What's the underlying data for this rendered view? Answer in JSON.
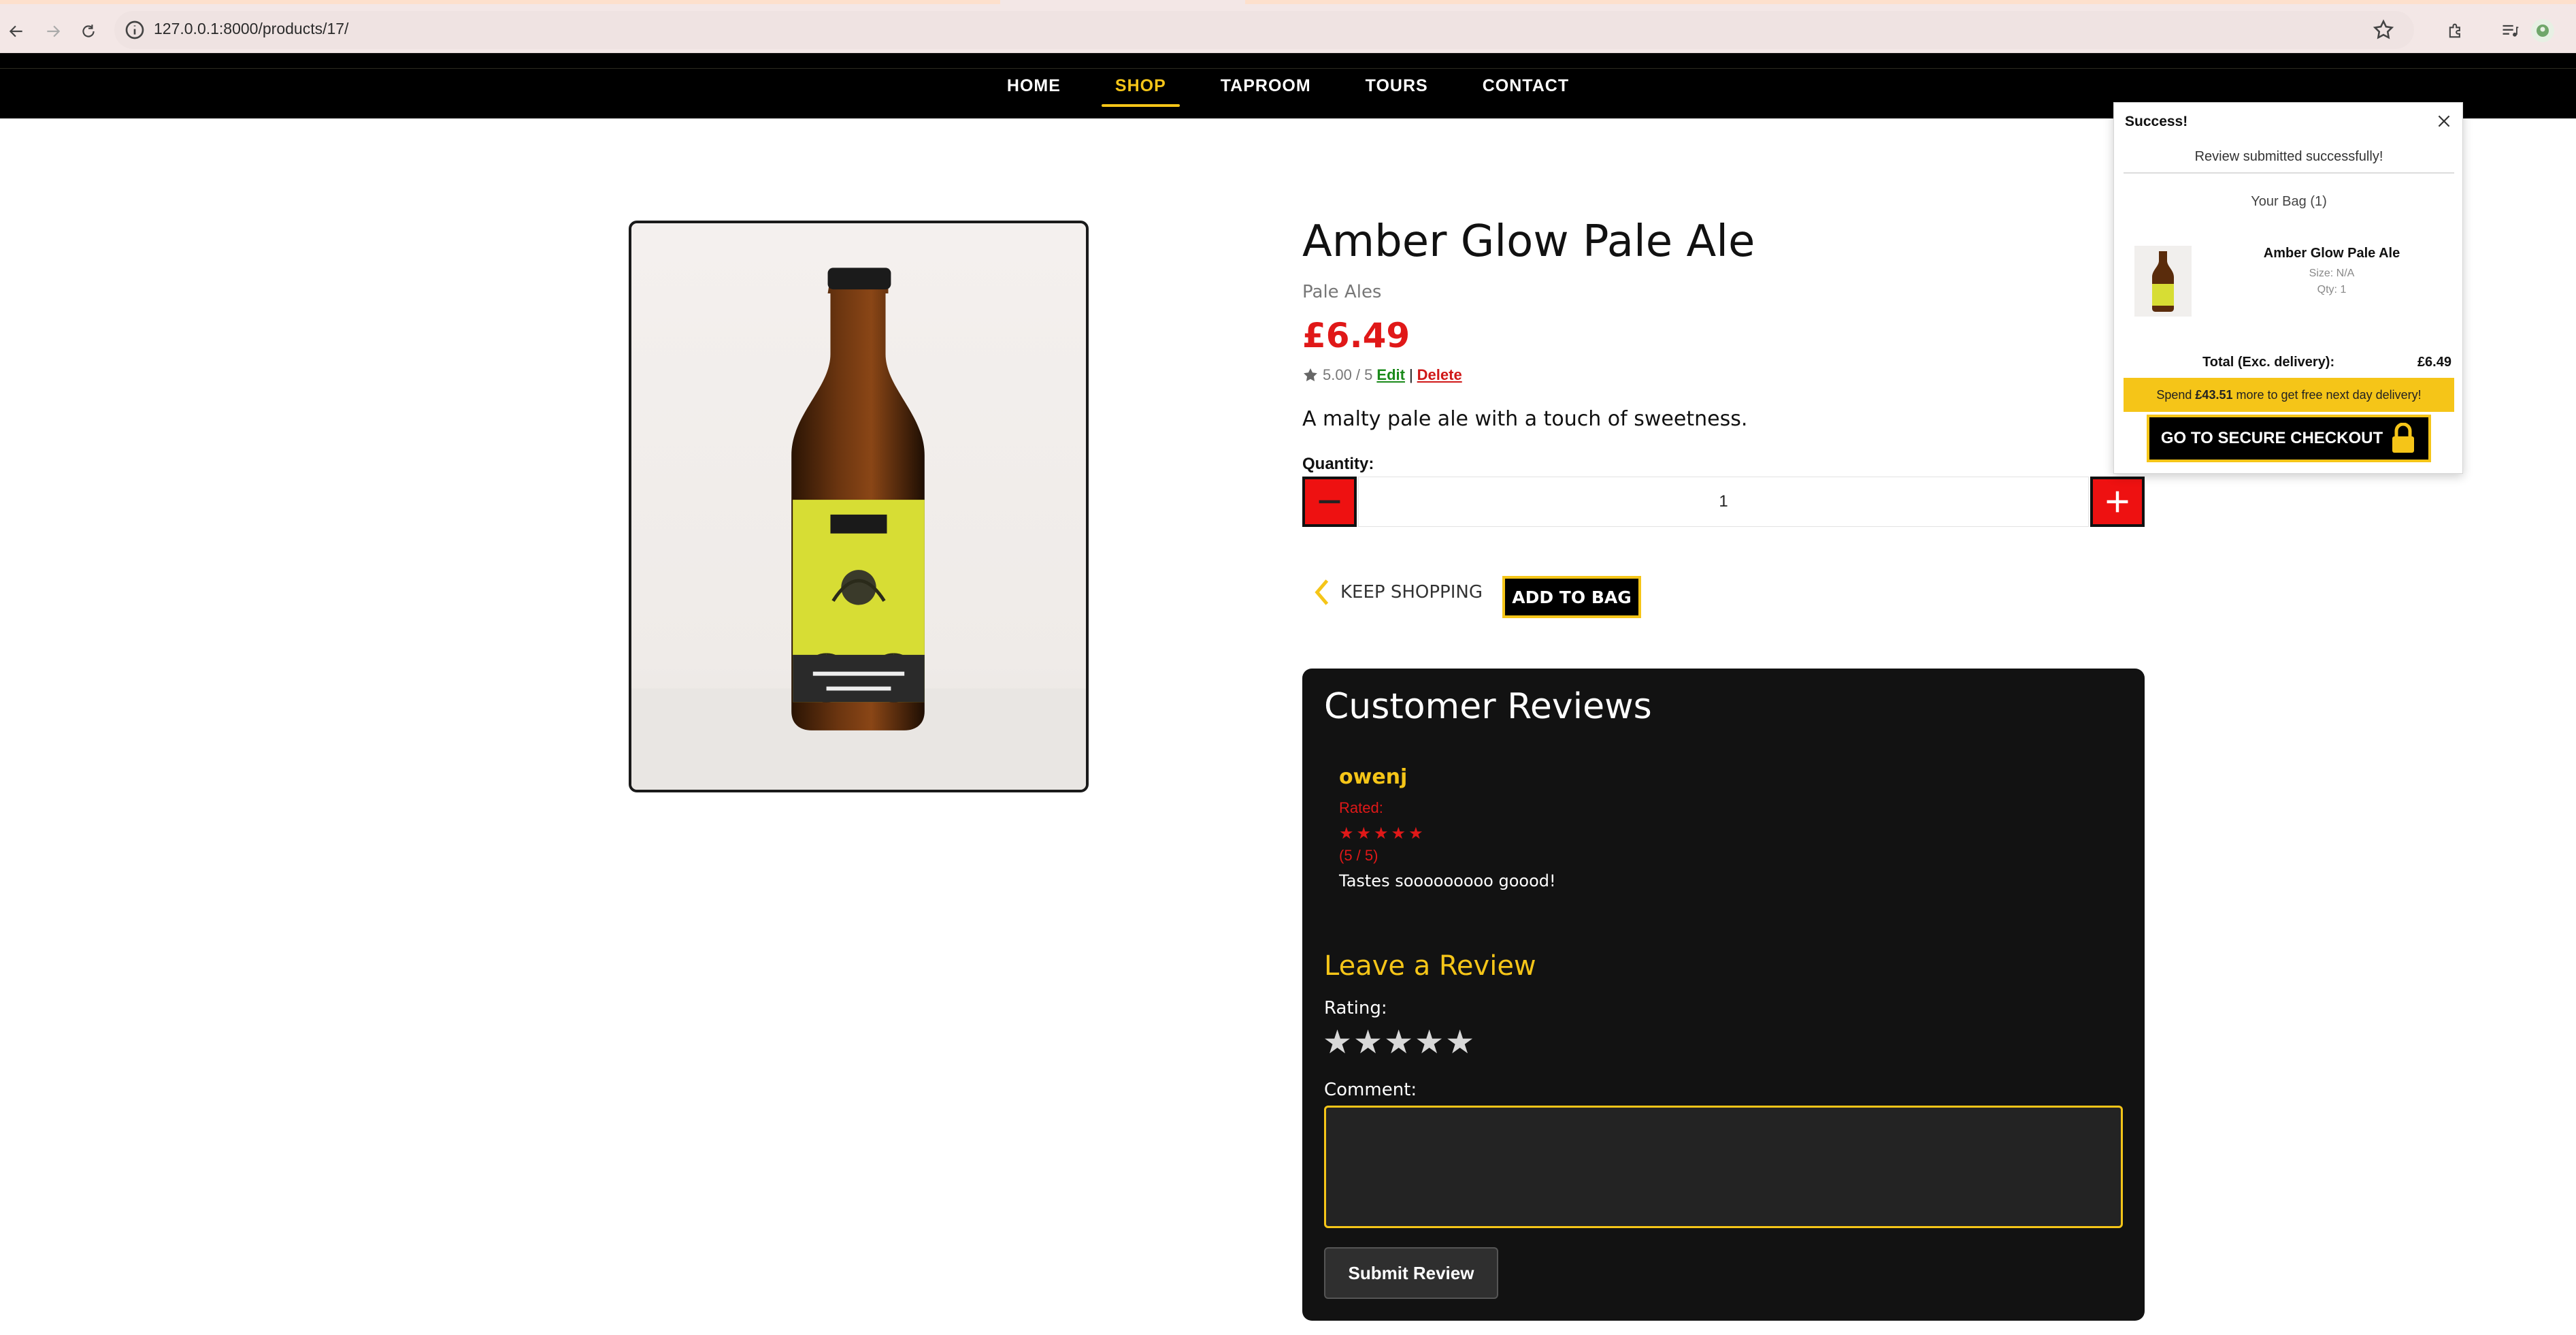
{
  "browser": {
    "url": "127.0.0.1:8000/products/17/"
  },
  "nav": {
    "items": [
      "HOME",
      "SHOP",
      "TAPROOM",
      "TOURS",
      "CONTACT"
    ],
    "active": "SHOP"
  },
  "product": {
    "title": "Amber Glow Pale Ale",
    "category": "Pale Ales",
    "price": "£6.49",
    "rating": "5.00 / 5",
    "edit_label": "Edit",
    "separator": "|",
    "delete_label": "Delete",
    "description": "A malty pale ale with a touch of sweetness.",
    "quantity_label": "Quantity:",
    "quantity_value": "1",
    "keep_shopping_label": "KEEP SHOPPING",
    "add_to_bag_label": "ADD TO BAG"
  },
  "reviews": {
    "title": "Customer Reviews",
    "items": [
      {
        "user": "owenj",
        "rated_label": "Rated:",
        "stars": "★★★★★",
        "score": "(5 / 5)",
        "comment": "Tastes sooooooooo goood!"
      }
    ],
    "leave_title": "Leave a Review",
    "rating_label": "Rating:",
    "rating_stars": [
      "★",
      "★",
      "★",
      "★",
      "★"
    ],
    "comment_label": "Comment:",
    "submit_label": "Submit Review"
  },
  "toast": {
    "heading": "Success!",
    "message": "Review submitted successfully!",
    "bag_label": "Your Bag (1)",
    "item_name": "Amber Glow Pale Ale",
    "item_size": "Size: N/A",
    "item_qty": "Qty: 1",
    "total_label": "Total (Exc. delivery):",
    "total_value": "£6.49",
    "free_prefix": "Spend",
    "free_amount": "£43.51",
    "free_suffix": "more to get free next day delivery!",
    "checkout_label": "GO TO SECURE CHECKOUT"
  },
  "colors": {
    "accent": "#f5c518",
    "price": "#e01818",
    "nav_bg": "#000000",
    "panel_bg": "#121212"
  }
}
